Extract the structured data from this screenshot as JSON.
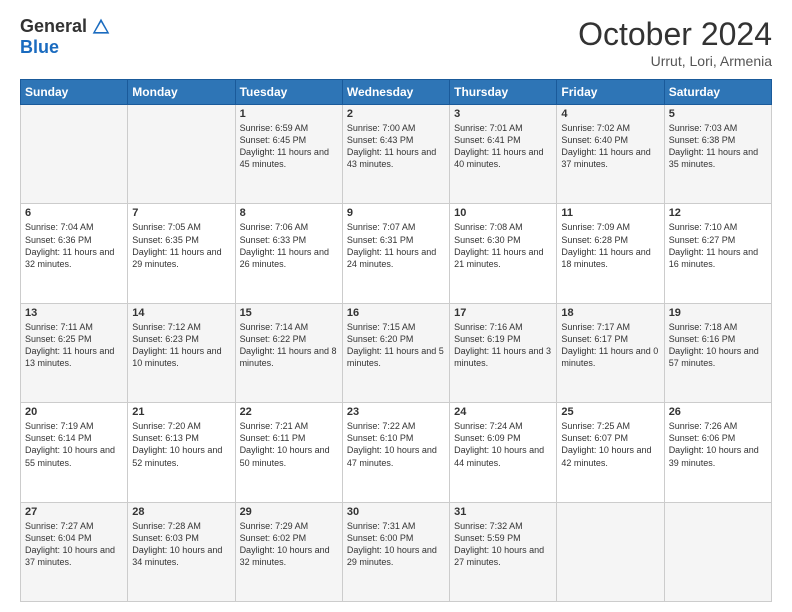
{
  "logo": {
    "general": "General",
    "blue": "Blue"
  },
  "title": "October 2024",
  "subtitle": "Urrut, Lori, Armenia",
  "days": [
    "Sunday",
    "Monday",
    "Tuesday",
    "Wednesday",
    "Thursday",
    "Friday",
    "Saturday"
  ],
  "weeks": [
    [
      {
        "day": "",
        "content": ""
      },
      {
        "day": "",
        "content": ""
      },
      {
        "day": "1",
        "content": "Sunrise: 6:59 AM\nSunset: 6:45 PM\nDaylight: 11 hours and 45 minutes."
      },
      {
        "day": "2",
        "content": "Sunrise: 7:00 AM\nSunset: 6:43 PM\nDaylight: 11 hours and 43 minutes."
      },
      {
        "day": "3",
        "content": "Sunrise: 7:01 AM\nSunset: 6:41 PM\nDaylight: 11 hours and 40 minutes."
      },
      {
        "day": "4",
        "content": "Sunrise: 7:02 AM\nSunset: 6:40 PM\nDaylight: 11 hours and 37 minutes."
      },
      {
        "day": "5",
        "content": "Sunrise: 7:03 AM\nSunset: 6:38 PM\nDaylight: 11 hours and 35 minutes."
      }
    ],
    [
      {
        "day": "6",
        "content": "Sunrise: 7:04 AM\nSunset: 6:36 PM\nDaylight: 11 hours and 32 minutes."
      },
      {
        "day": "7",
        "content": "Sunrise: 7:05 AM\nSunset: 6:35 PM\nDaylight: 11 hours and 29 minutes."
      },
      {
        "day": "8",
        "content": "Sunrise: 7:06 AM\nSunset: 6:33 PM\nDaylight: 11 hours and 26 minutes."
      },
      {
        "day": "9",
        "content": "Sunrise: 7:07 AM\nSunset: 6:31 PM\nDaylight: 11 hours and 24 minutes."
      },
      {
        "day": "10",
        "content": "Sunrise: 7:08 AM\nSunset: 6:30 PM\nDaylight: 11 hours and 21 minutes."
      },
      {
        "day": "11",
        "content": "Sunrise: 7:09 AM\nSunset: 6:28 PM\nDaylight: 11 hours and 18 minutes."
      },
      {
        "day": "12",
        "content": "Sunrise: 7:10 AM\nSunset: 6:27 PM\nDaylight: 11 hours and 16 minutes."
      }
    ],
    [
      {
        "day": "13",
        "content": "Sunrise: 7:11 AM\nSunset: 6:25 PM\nDaylight: 11 hours and 13 minutes."
      },
      {
        "day": "14",
        "content": "Sunrise: 7:12 AM\nSunset: 6:23 PM\nDaylight: 11 hours and 10 minutes."
      },
      {
        "day": "15",
        "content": "Sunrise: 7:14 AM\nSunset: 6:22 PM\nDaylight: 11 hours and 8 minutes."
      },
      {
        "day": "16",
        "content": "Sunrise: 7:15 AM\nSunset: 6:20 PM\nDaylight: 11 hours and 5 minutes."
      },
      {
        "day": "17",
        "content": "Sunrise: 7:16 AM\nSunset: 6:19 PM\nDaylight: 11 hours and 3 minutes."
      },
      {
        "day": "18",
        "content": "Sunrise: 7:17 AM\nSunset: 6:17 PM\nDaylight: 11 hours and 0 minutes."
      },
      {
        "day": "19",
        "content": "Sunrise: 7:18 AM\nSunset: 6:16 PM\nDaylight: 10 hours and 57 minutes."
      }
    ],
    [
      {
        "day": "20",
        "content": "Sunrise: 7:19 AM\nSunset: 6:14 PM\nDaylight: 10 hours and 55 minutes."
      },
      {
        "day": "21",
        "content": "Sunrise: 7:20 AM\nSunset: 6:13 PM\nDaylight: 10 hours and 52 minutes."
      },
      {
        "day": "22",
        "content": "Sunrise: 7:21 AM\nSunset: 6:11 PM\nDaylight: 10 hours and 50 minutes."
      },
      {
        "day": "23",
        "content": "Sunrise: 7:22 AM\nSunset: 6:10 PM\nDaylight: 10 hours and 47 minutes."
      },
      {
        "day": "24",
        "content": "Sunrise: 7:24 AM\nSunset: 6:09 PM\nDaylight: 10 hours and 44 minutes."
      },
      {
        "day": "25",
        "content": "Sunrise: 7:25 AM\nSunset: 6:07 PM\nDaylight: 10 hours and 42 minutes."
      },
      {
        "day": "26",
        "content": "Sunrise: 7:26 AM\nSunset: 6:06 PM\nDaylight: 10 hours and 39 minutes."
      }
    ],
    [
      {
        "day": "27",
        "content": "Sunrise: 7:27 AM\nSunset: 6:04 PM\nDaylight: 10 hours and 37 minutes."
      },
      {
        "day": "28",
        "content": "Sunrise: 7:28 AM\nSunset: 6:03 PM\nDaylight: 10 hours and 34 minutes."
      },
      {
        "day": "29",
        "content": "Sunrise: 7:29 AM\nSunset: 6:02 PM\nDaylight: 10 hours and 32 minutes."
      },
      {
        "day": "30",
        "content": "Sunrise: 7:31 AM\nSunset: 6:00 PM\nDaylight: 10 hours and 29 minutes."
      },
      {
        "day": "31",
        "content": "Sunrise: 7:32 AM\nSunset: 5:59 PM\nDaylight: 10 hours and 27 minutes."
      },
      {
        "day": "",
        "content": ""
      },
      {
        "day": "",
        "content": ""
      }
    ]
  ]
}
